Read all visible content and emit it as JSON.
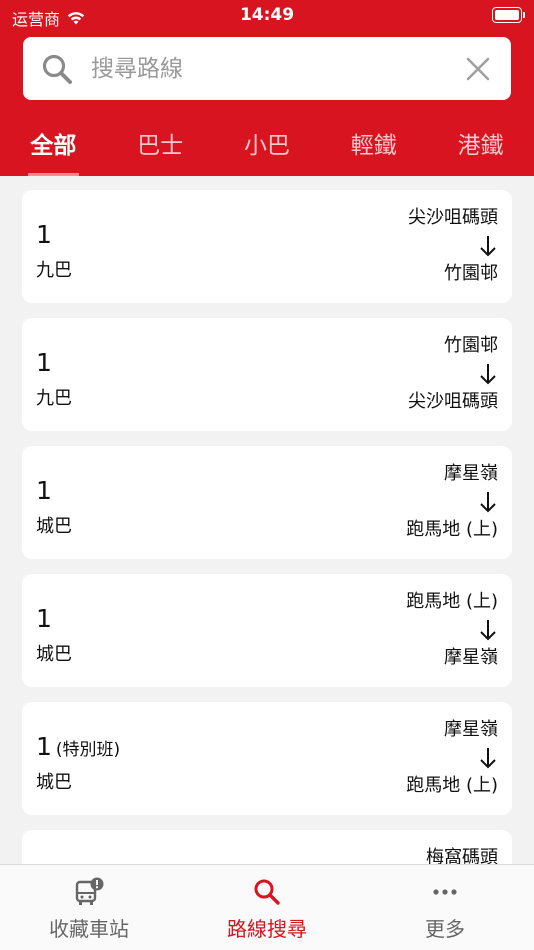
{
  "status_bar": {
    "carrier": "运营商",
    "time": "14:49"
  },
  "search": {
    "placeholder": "搜尋路線",
    "value": ""
  },
  "tabs": [
    {
      "label": "全部",
      "active": true
    },
    {
      "label": "巴士",
      "active": false
    },
    {
      "label": "小巴",
      "active": false
    },
    {
      "label": "輕鐵",
      "active": false
    },
    {
      "label": "港鐵",
      "active": false
    }
  ],
  "routes": [
    {
      "route": "1",
      "note": "",
      "operator": "九巴",
      "origin": "尖沙咀碼頭",
      "destination": "竹園邨"
    },
    {
      "route": "1",
      "note": "",
      "operator": "九巴",
      "origin": "竹園邨",
      "destination": "尖沙咀碼頭"
    },
    {
      "route": "1",
      "note": "",
      "operator": "城巴",
      "origin": "摩星嶺",
      "destination": "跑馬地 (上)"
    },
    {
      "route": "1",
      "note": "",
      "operator": "城巴",
      "origin": "跑馬地 (上)",
      "destination": "摩星嶺"
    },
    {
      "route": "1",
      "note": "(特別班)",
      "operator": "城巴",
      "origin": "摩星嶺",
      "destination": "跑馬地 (上)"
    },
    {
      "route": "",
      "note": "",
      "operator": "",
      "origin": "梅窩碼頭",
      "destination": ""
    }
  ],
  "bottom_nav": [
    {
      "label": "收藏車站",
      "icon": "bus-alert-icon",
      "active": false
    },
    {
      "label": "路線搜尋",
      "icon": "search-icon",
      "active": true
    },
    {
      "label": "更多",
      "icon": "more-dots-icon",
      "active": false
    }
  ],
  "colors": {
    "brand_red": "#d7141f",
    "background": "#f2f2f2"
  }
}
